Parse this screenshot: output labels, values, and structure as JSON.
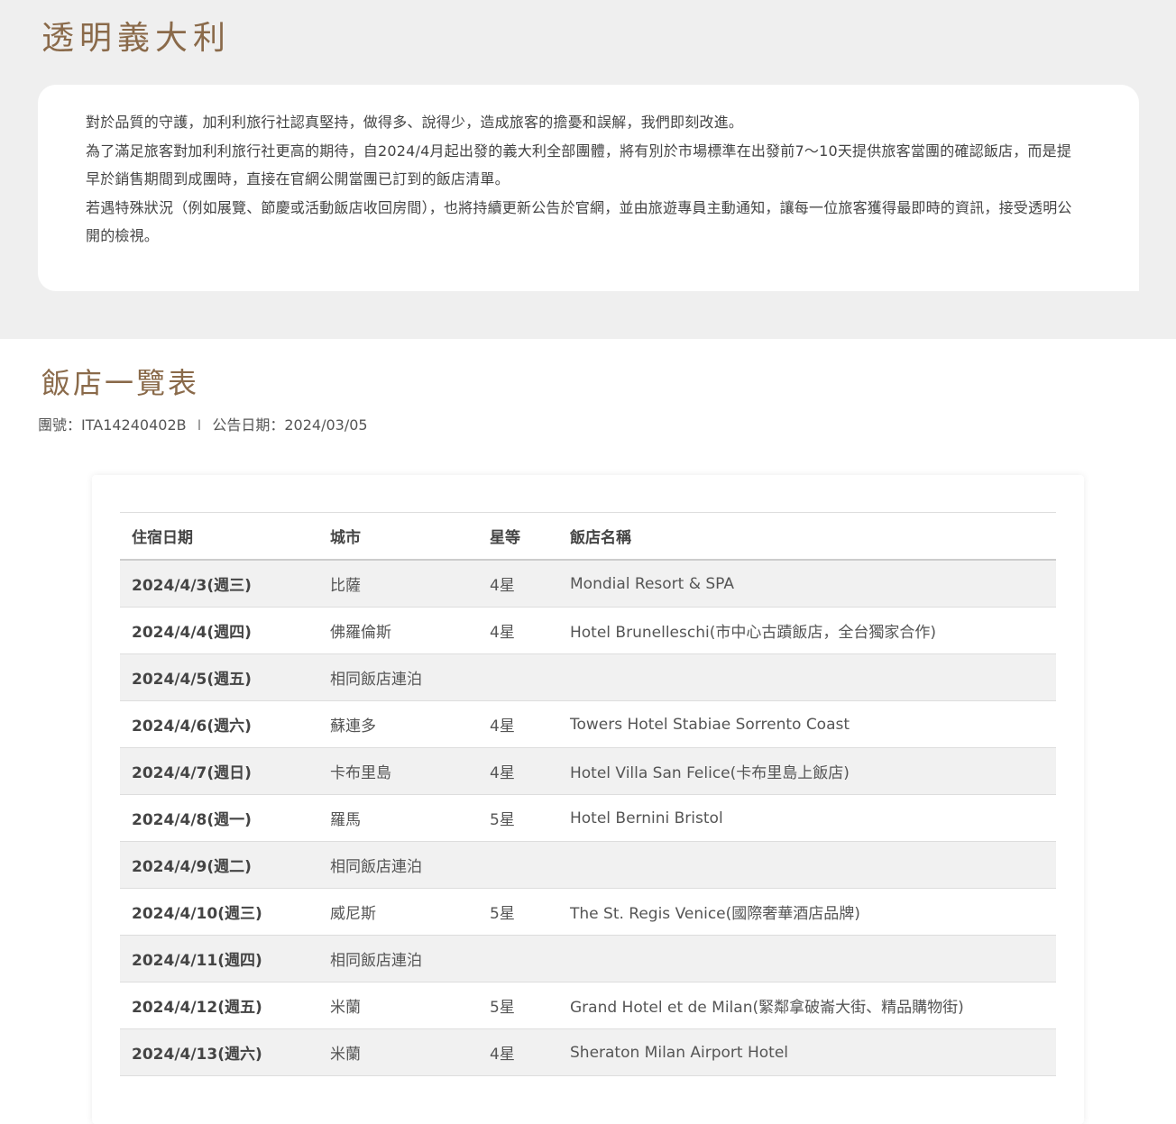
{
  "transparency": {
    "title": "透明義大利",
    "paragraphs": [
      "對於品質的守護，加利利旅行社認真堅持，做得多、說得少，造成旅客的擔憂和誤解，我們即刻改進。",
      "為了滿足旅客對加利利旅行社更高的期待，自2024/4月起出發的義大利全部團體，將有別於市場標準在出發前7～10天提供旅客當團的確認飯店，而是提早於銷售期間到成團時，直接在官網公開當團已訂到的飯店清單。",
      "若遇特殊狀況（例如展覽、節慶或活動飯店收回房間），也將持續更新公告於官網，並由旅遊專員主動通知，讓每一位旅客獲得最即時的資訊，接受透明公開的檢視。"
    ]
  },
  "hotel_list": {
    "title": "飯店一覽表",
    "tour_no": "團號：ITA14240402B",
    "separator": "I",
    "announce_date": "公告日期：2024/03/05",
    "headers": {
      "date": "住宿日期",
      "city": "城市",
      "star": "星等",
      "hotel": "飯店名稱"
    },
    "rows": [
      {
        "date": "2024/4/3(週三)",
        "city": "比薩",
        "star": "4星",
        "hotel": "Mondial Resort & SPA"
      },
      {
        "date": "2024/4/4(週四)",
        "city": "佛羅倫斯",
        "star": "4星",
        "hotel": "Hotel Brunelleschi(市中心古蹟飯店，全台獨家合作)"
      },
      {
        "date": "2024/4/5(週五)",
        "city": "相同飯店連泊",
        "star": "",
        "hotel": ""
      },
      {
        "date": "2024/4/6(週六)",
        "city": "蘇連多",
        "star": "4星",
        "hotel": "Towers Hotel Stabiae Sorrento Coast"
      },
      {
        "date": "2024/4/7(週日)",
        "city": "卡布里島",
        "star": "4星",
        "hotel": "Hotel Villa San Felice(卡布里島上飯店)"
      },
      {
        "date": "2024/4/8(週一)",
        "city": "羅馬",
        "star": "5星",
        "hotel": "Hotel Bernini Bristol"
      },
      {
        "date": "2024/4/9(週二)",
        "city": "相同飯店連泊",
        "star": "",
        "hotel": ""
      },
      {
        "date": "2024/4/10(週三)",
        "city": "威尼斯",
        "star": "5星",
        "hotel": "The St. Regis Venice(國際奢華酒店品牌)"
      },
      {
        "date": "2024/4/11(週四)",
        "city": "相同飯店連泊",
        "star": "",
        "hotel": ""
      },
      {
        "date": "2024/4/12(週五)",
        "city": "米蘭",
        "star": "5星",
        "hotel": "Grand Hotel et de Milan(緊鄰拿破崙大街、精品購物街)"
      },
      {
        "date": "2024/4/13(週六)",
        "city": "米蘭",
        "star": "4星",
        "hotel": "Sheraton Milan Airport Hotel"
      }
    ]
  },
  "colors": {
    "title_brown": "#8a6a4a",
    "top_background": "#efefef",
    "row_stripe": "#f1f1f1"
  }
}
